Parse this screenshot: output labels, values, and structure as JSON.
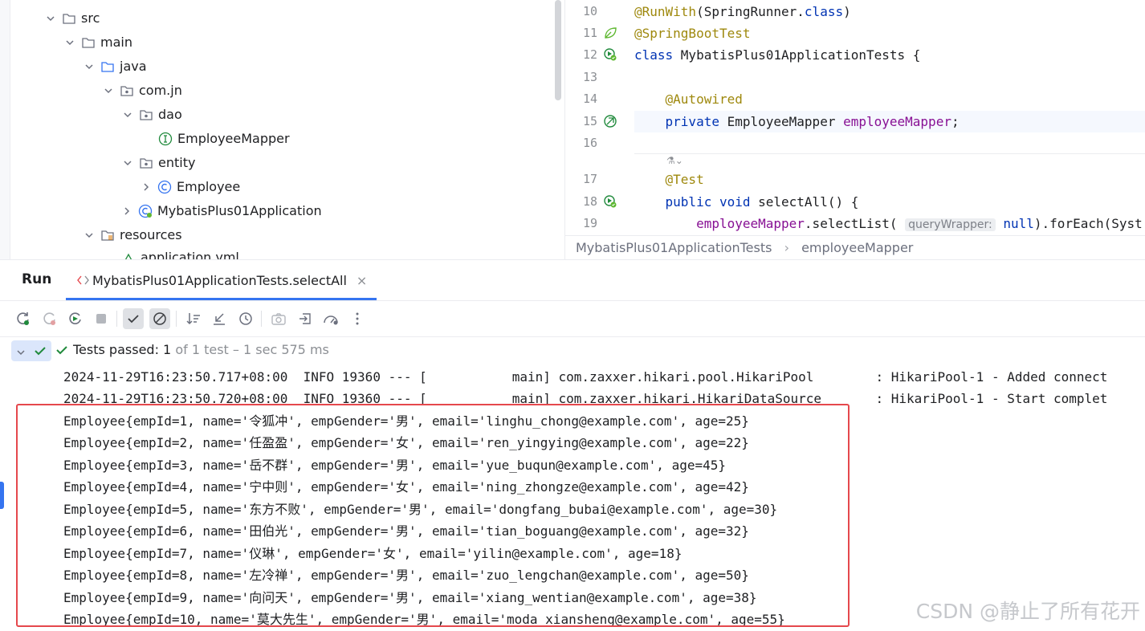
{
  "tree": {
    "items": [
      {
        "label": "src",
        "type": "folder",
        "expanded": true
      },
      {
        "label": "main",
        "type": "folder",
        "expanded": true
      },
      {
        "label": "java",
        "type": "source-folder",
        "expanded": true
      },
      {
        "label": "com.jn",
        "type": "package",
        "expanded": true
      },
      {
        "label": "dao",
        "type": "package",
        "expanded": true
      },
      {
        "label": "EmployeeMapper",
        "type": "interface"
      },
      {
        "label": "entity",
        "type": "package",
        "expanded": true
      },
      {
        "label": "Employee",
        "type": "class",
        "expanded": false
      },
      {
        "label": "MybatisPlus01Application",
        "type": "spring-class",
        "expanded": false
      },
      {
        "label": "resources",
        "type": "resources-folder",
        "expanded": true
      },
      {
        "label": "application.yml",
        "type": "yaml"
      }
    ]
  },
  "editor": {
    "lines": [
      {
        "num": "10",
        "icon": "",
        "parts": [
          [
            "ann",
            "@RunWith"
          ],
          [
            "",
            "(SpringRunner."
          ],
          [
            "kw",
            "class"
          ],
          [
            "",
            ")"
          ]
        ]
      },
      {
        "num": "11",
        "icon": "spring-leaf-icon",
        "parts": [
          [
            "ann",
            "@SpringBootTest"
          ]
        ]
      },
      {
        "num": "12",
        "icon": "run-test-icon",
        "parts": [
          [
            "kw",
            "class "
          ],
          [
            "",
            "MybatisPlus01ApplicationTests {"
          ]
        ]
      },
      {
        "num": "13",
        "icon": "",
        "parts": []
      },
      {
        "num": "14",
        "icon": "",
        "parts": [
          [
            "",
            "    "
          ],
          [
            "ann",
            "@Autowired"
          ]
        ]
      },
      {
        "num": "15",
        "icon": "spring-bean-icon",
        "parts": [
          [
            "",
            "    "
          ],
          [
            "kw",
            "private "
          ],
          [
            "",
            "EmployeeMapper "
          ],
          [
            "fld",
            "employeeMapper"
          ],
          [
            "",
            ";"
          ]
        ]
      },
      {
        "num": "16",
        "icon": "",
        "parts": []
      },
      {
        "num": "17",
        "icon": "",
        "parts": [
          [
            "",
            "    "
          ],
          [
            "ann",
            "@Test"
          ]
        ]
      },
      {
        "num": "18",
        "icon": "run-test-icon",
        "parts": [
          [
            "",
            "    "
          ],
          [
            "kw",
            "public void "
          ],
          [
            "",
            "selectAll() {"
          ]
        ]
      },
      {
        "num": "19",
        "icon": "",
        "parts": [
          [
            "",
            "        "
          ],
          [
            "fld",
            "employeeMapper"
          ],
          [
            "",
            ".selectList( "
          ],
          [
            "hint",
            "queryWrapper:"
          ],
          [
            "kw",
            " null"
          ],
          [
            "",
            ").forEach(Syst"
          ]
        ]
      }
    ],
    "breadcrumb": [
      "MybatisPlus01ApplicationTests",
      "employeeMapper"
    ]
  },
  "run": {
    "panel_title": "Run",
    "tab_label": "MybatisPlus01ApplicationTests.selectAll",
    "status_prefix": "Tests passed: ",
    "status_count": "1",
    "status_rest": " of 1 test – 1 sec 575 ms",
    "console_lines": [
      "2024-11-29T16:23:50.717+08:00  INFO 19360 --- [           main] com.zaxxer.hikari.pool.HikariPool        : HikariPool-1 - Added connect",
      "2024-11-29T16:23:50.720+08:00  INFO 19360 --- [           main] com.zaxxer.hikari.HikariDataSource       : HikariPool-1 - Start complet",
      "Employee{empId=1, name='令狐冲', empGender='男', email='linghu_chong@example.com', age=25}",
      "Employee{empId=2, name='任盈盈', empGender='女', email='ren_yingying@example.com', age=22}",
      "Employee{empId=3, name='岳不群', empGender='男', email='yue_buqun@example.com', age=45}",
      "Employee{empId=4, name='宁中则', empGender='女', email='ning_zhongze@example.com', age=42}",
      "Employee{empId=5, name='东方不败', empGender='男', email='dongfang_bubai@example.com', age=30}",
      "Employee{empId=6, name='田伯光', empGender='男', email='tian_boguang@example.com', age=32}",
      "Employee{empId=7, name='仪琳', empGender='女', email='yilin@example.com', age=18}",
      "Employee{empId=8, name='左冷禅', empGender='男', email='zuo_lengchan@example.com', age=50}",
      "Employee{empId=9, name='向问天', empGender='男', email='xiang_wentian@example.com', age=38}",
      "Employee{empId=10, name='莫大先生', empGender='男', email='moda_xiansheng@example.com', age=55}"
    ]
  },
  "watermark": "CSDN @静止了所有花开",
  "colors": {
    "accent": "#3574f0",
    "pass_green": "#208a3c",
    "annotation": "#9e880d",
    "keyword": "#0033b3",
    "field": "#871094",
    "highlight_box": "#e5484d"
  }
}
